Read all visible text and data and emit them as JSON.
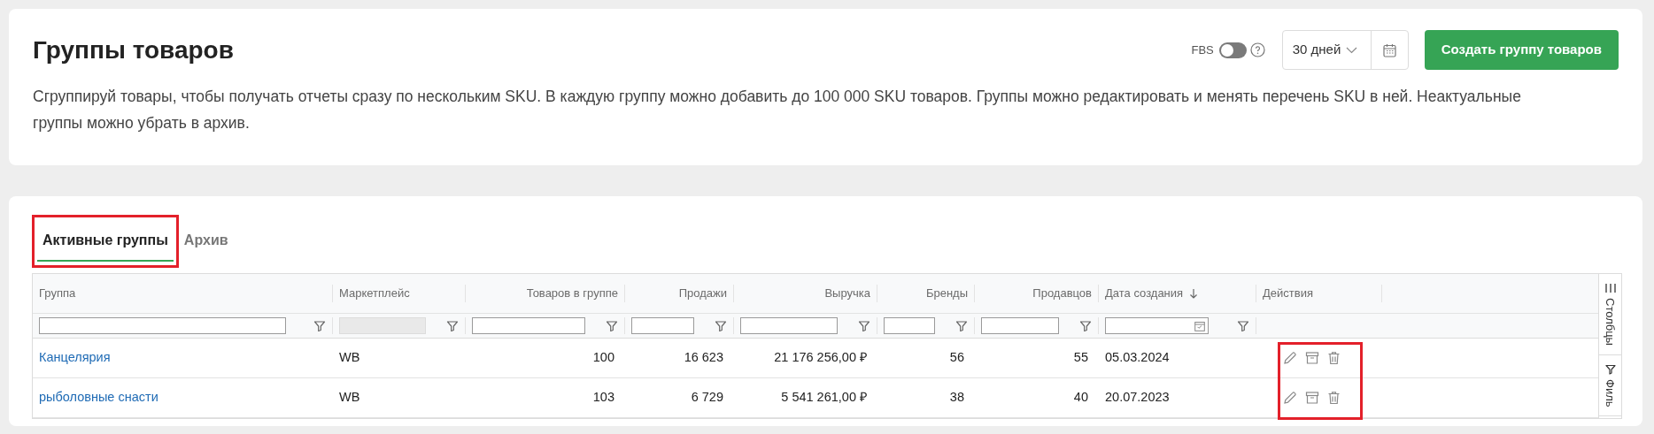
{
  "header": {
    "title": "Группы товаров",
    "description": "Сгруппируй товары, чтобы получать отчеты сразу по нескольким SKU. В каждую группу можно добавить до 100 000 SKU товаров. Группы можно редактировать и менять перечень SKU в ней. Неактуальные группы можно убрать в архив.",
    "fbs": {
      "label": "FBS",
      "on": false
    },
    "period": "30 дней",
    "create_button": "Создать группу товаров"
  },
  "tabs": [
    {
      "label": "Активные группы",
      "selected": true,
      "highlighted": true
    },
    {
      "label": "Архив",
      "selected": false,
      "highlighted": false
    }
  ],
  "table": {
    "columns": [
      {
        "label": "Группа",
        "kind": "link",
        "sorted_descending": false
      },
      {
        "label": "Маркетплейс",
        "kind": "text",
        "sorted_descending": false
      },
      {
        "label": "Товаров в группе",
        "kind": "number",
        "sorted_descending": false
      },
      {
        "label": "Продажи",
        "kind": "number",
        "sorted_descending": false
      },
      {
        "label": "Выручка",
        "kind": "number",
        "sorted_descending": false
      },
      {
        "label": "Бренды",
        "kind": "number",
        "sorted_descending": false
      },
      {
        "label": "Продавцов",
        "kind": "number",
        "sorted_descending": false
      },
      {
        "label": "Дата создания",
        "kind": "text",
        "sorted_descending": true
      },
      {
        "label": "Действия",
        "kind": "actions",
        "sorted_descending": false
      }
    ],
    "filters": [
      {
        "kind": "text"
      },
      {
        "kind": "disabled"
      },
      {
        "kind": "text"
      },
      {
        "kind": "text"
      },
      {
        "kind": "text"
      },
      {
        "kind": "text"
      },
      {
        "kind": "text"
      },
      {
        "kind": "date"
      }
    ],
    "rows": [
      {
        "cells": [
          "Канцелярия",
          "WB",
          "100",
          "16 623",
          "21 176 256,00 ₽",
          "56",
          "55",
          "05.03.2024"
        ]
      },
      {
        "cells": [
          "рыболовные снасти",
          "WB",
          "103",
          "6 729",
          "5 541 261,00 ₽",
          "38",
          "40",
          "20.07.2023"
        ]
      }
    ],
    "actions_highlighted": true
  },
  "side_panel": [
    "Столбцы",
    "Филь"
  ]
}
